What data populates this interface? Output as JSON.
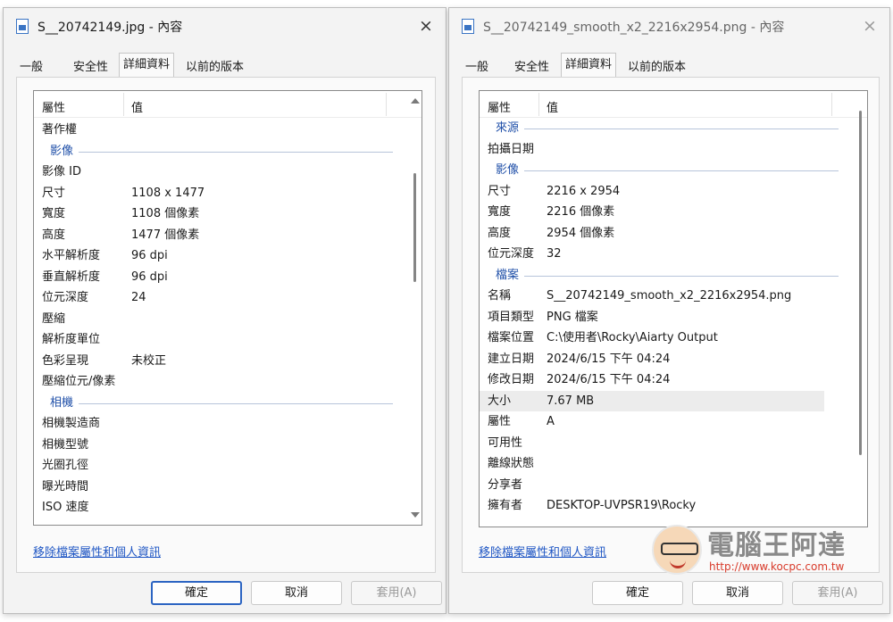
{
  "left_dialog": {
    "title": "S__20742149.jpg - 內容",
    "close_icon": "×",
    "tabs": [
      "一般",
      "安全性",
      "詳細資料",
      "以前的版本"
    ],
    "active_tab": "詳細資料",
    "columns": {
      "property": "屬性",
      "value": "值"
    },
    "rows": [
      {
        "type": "item",
        "key": "著作權",
        "value": ""
      },
      {
        "type": "group",
        "label": "影像"
      },
      {
        "type": "item",
        "key": "影像 ID",
        "value": ""
      },
      {
        "type": "item",
        "key": "尺寸",
        "value": "1108 x 1477"
      },
      {
        "type": "item",
        "key": "寬度",
        "value": "1108 個像素"
      },
      {
        "type": "item",
        "key": "高度",
        "value": "1477 個像素"
      },
      {
        "type": "item",
        "key": "水平解析度",
        "value": "96 dpi"
      },
      {
        "type": "item",
        "key": "垂直解析度",
        "value": "96 dpi"
      },
      {
        "type": "item",
        "key": "位元深度",
        "value": "24"
      },
      {
        "type": "item",
        "key": "壓縮",
        "value": ""
      },
      {
        "type": "item",
        "key": "解析度單位",
        "value": ""
      },
      {
        "type": "item",
        "key": "色彩呈現",
        "value": "未校正"
      },
      {
        "type": "item",
        "key": "壓縮位元/像素",
        "value": ""
      },
      {
        "type": "group",
        "label": "相機"
      },
      {
        "type": "item",
        "key": "相機製造商",
        "value": ""
      },
      {
        "type": "item",
        "key": "相機型號",
        "value": ""
      },
      {
        "type": "item",
        "key": "光圈孔徑",
        "value": ""
      },
      {
        "type": "item",
        "key": "曝光時間",
        "value": ""
      },
      {
        "type": "item",
        "key": "ISO 速度",
        "value": ""
      }
    ],
    "remove_link": "移除檔案屬性和個人資訊",
    "buttons": {
      "ok": "確定",
      "cancel": "取消",
      "apply": "套用(A)"
    }
  },
  "right_dialog": {
    "title": "S__20742149_smooth_x2_2216x2954.png - 內容",
    "close_icon": "×",
    "tabs": [
      "一般",
      "安全性",
      "詳細資料",
      "以前的版本"
    ],
    "active_tab": "詳細資料",
    "columns": {
      "property": "屬性",
      "value": "值"
    },
    "rows": [
      {
        "type": "group",
        "label": "來源"
      },
      {
        "type": "item",
        "key": "拍攝日期",
        "value": ""
      },
      {
        "type": "group",
        "label": "影像"
      },
      {
        "type": "item",
        "key": "尺寸",
        "value": "2216 x 2954"
      },
      {
        "type": "item",
        "key": "寬度",
        "value": "2216 個像素"
      },
      {
        "type": "item",
        "key": "高度",
        "value": "2954 個像素"
      },
      {
        "type": "item",
        "key": "位元深度",
        "value": "32"
      },
      {
        "type": "group",
        "label": "檔案"
      },
      {
        "type": "item",
        "key": "名稱",
        "value": "S__20742149_smooth_x2_2216x2954.png"
      },
      {
        "type": "item",
        "key": "項目類型",
        "value": "PNG 檔案"
      },
      {
        "type": "item",
        "key": "檔案位置",
        "value": "C:\\使用者\\Rocky\\Aiarty Output"
      },
      {
        "type": "item",
        "key": "建立日期",
        "value": "2024/6/15 下午 04:24"
      },
      {
        "type": "item",
        "key": "修改日期",
        "value": "2024/6/15 下午 04:24"
      },
      {
        "type": "item",
        "key": "大小",
        "value": "7.67 MB",
        "selected": true
      },
      {
        "type": "item",
        "key": "屬性",
        "value": "A"
      },
      {
        "type": "item",
        "key": "可用性",
        "value": ""
      },
      {
        "type": "item",
        "key": "離線狀態",
        "value": ""
      },
      {
        "type": "item",
        "key": "分享者",
        "value": ""
      },
      {
        "type": "item",
        "key": "擁有者",
        "value": "DESKTOP-UVPSR19\\Rocky"
      }
    ],
    "remove_link": "移除檔案屬性和個人資訊",
    "buttons": {
      "ok": "確定",
      "cancel": "取消",
      "apply": "套用(A)"
    }
  },
  "watermark": {
    "title": "電腦王阿達",
    "url": "http://www.kocpc.com.tw"
  }
}
